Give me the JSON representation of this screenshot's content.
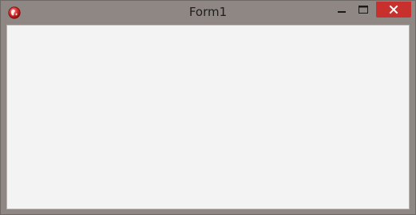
{
  "window": {
    "title": "Form1",
    "app_icon": "app-globe-icon",
    "controls": {
      "minimize_icon": "minimize-icon",
      "maximize_icon": "maximize-icon",
      "close_icon": "close-icon"
    }
  },
  "colors": {
    "frame": "#8f8784",
    "client_background": "#f3f3f3",
    "close_button": "#c7302c",
    "title_text": "#1e1e1e"
  }
}
